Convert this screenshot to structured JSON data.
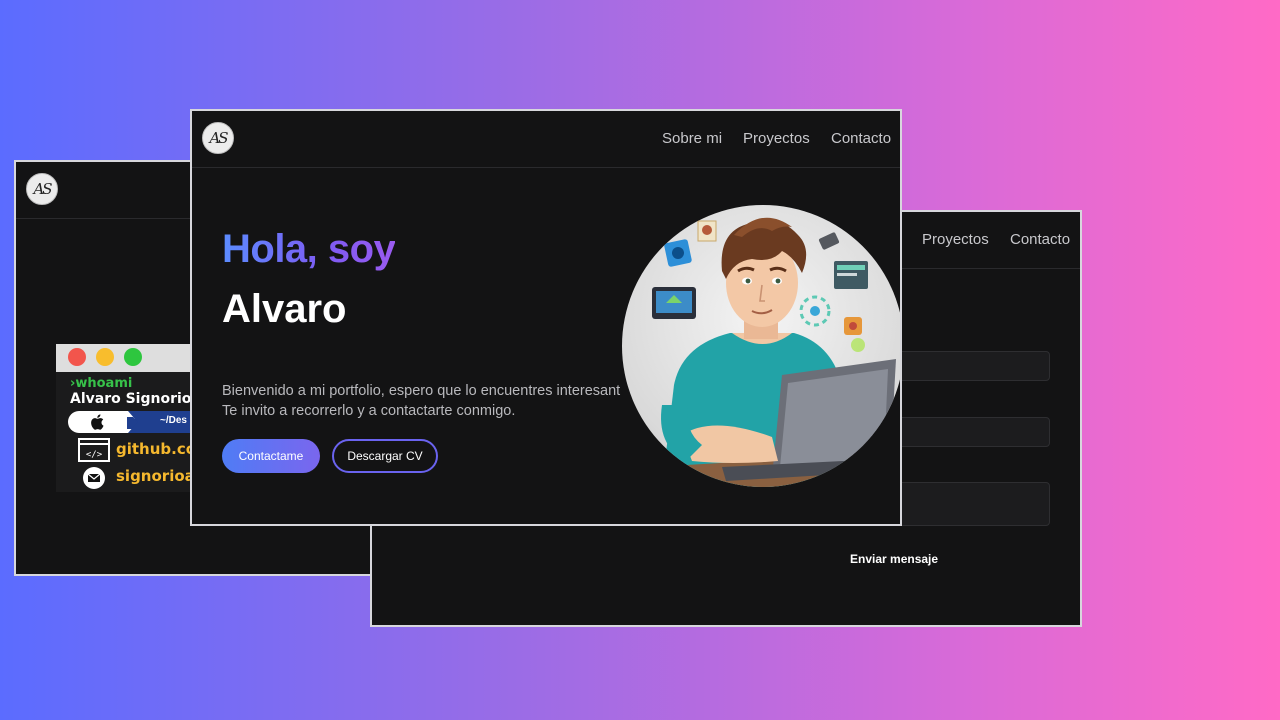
{
  "left_window": {
    "logo_text": "AS",
    "terminal": {
      "command": "whoami",
      "name": "Alvaro Signorio",
      "path": "~/Des",
      "github": "github.co",
      "email": "signorioa"
    }
  },
  "right_window": {
    "nav": [
      "Proyectos",
      "Contacto"
    ],
    "send_label": "Enviar mensaje"
  },
  "front_window": {
    "logo_text": "AS",
    "nav": [
      "Sobre mi",
      "Proyectos",
      "Contacto"
    ],
    "greeting": "Hola, soy",
    "name": "Alvaro",
    "intro_line1": "Bienvenido a mi portfolio, espero que lo encuentres interesant",
    "intro_line2": "Te invito a recorrerlo y a contactarte conmigo.",
    "contact_button": "Contactame",
    "cv_button": "Descargar CV"
  },
  "colors": {
    "background_left": "#5b6cff",
    "background_right": "#ff6ac6",
    "window_bg": "#131314",
    "accent_blue": "#4f7cf5",
    "accent_purple": "#7a66ee",
    "terminal_green": "#37c24a",
    "terminal_yellow": "#f5b82e"
  },
  "icons": [
    "apple-icon",
    "folder-icon",
    "code-window-icon",
    "mail-icon",
    "prompt-arrow-icon"
  ]
}
